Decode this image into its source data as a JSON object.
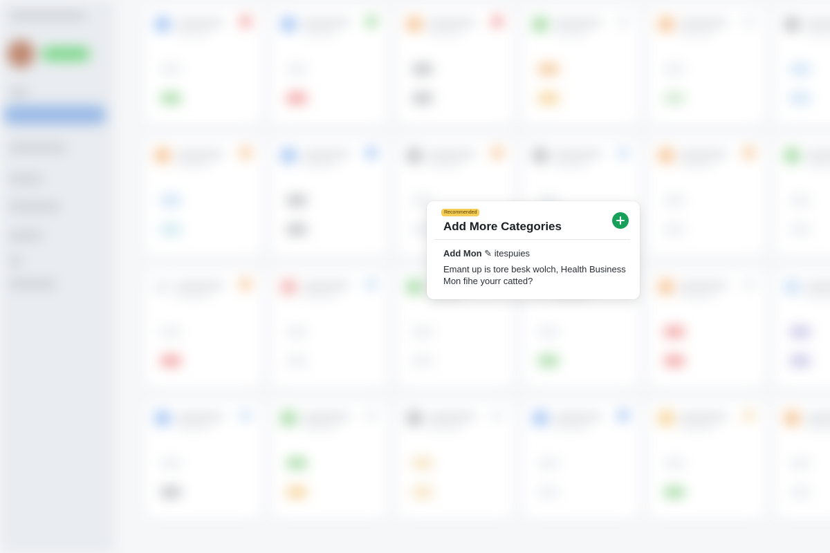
{
  "modal": {
    "tag": "Recommended",
    "title": "Add More Categories",
    "subtitle_bold": "Add Mon",
    "subtitle_icon": "edit-icon",
    "subtitle_rest": "itespuies",
    "body": "Emant up is tore besk wolch, Health Business Mon fihe yourr catted?",
    "add_button": "plus-icon"
  },
  "colors": {
    "accent_green": "#17a05a",
    "tag_yellow": "#f4cd56",
    "sidebar_active": "#9bbbe8"
  }
}
